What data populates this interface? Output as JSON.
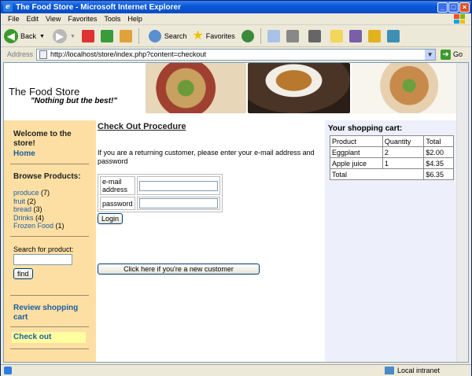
{
  "window": {
    "title": "The Food Store - Microsoft Internet Explorer"
  },
  "menu": [
    "File",
    "Edit",
    "View",
    "Favorites",
    "Tools",
    "Help"
  ],
  "toolbar": {
    "back_label": "Back",
    "search_label": "Search",
    "favorites_label": "Favorites"
  },
  "address": {
    "label": "Address",
    "url": "http://localhost/store/index.php?content=checkout",
    "go_label": "Go"
  },
  "banner": {
    "title": "The Food Store",
    "slogan": "\"Nothing but the best!\""
  },
  "sidebar": {
    "welcome": "Welcome to the store!",
    "home": "Home",
    "browse_heading": "Browse Products:",
    "categories": [
      {
        "name": "produce",
        "count": "(7)"
      },
      {
        "name": "fruit",
        "count": "(2)"
      },
      {
        "name": "bread",
        "count": "(3)"
      },
      {
        "name": "Drinks",
        "count": "(4)"
      },
      {
        "name": "Frozen Food",
        "count": "(1)"
      }
    ],
    "search_label": "Search for product:",
    "search_value": "",
    "find_label": "find",
    "review_cart": "Review shopping cart",
    "checkout": "Check out"
  },
  "main": {
    "heading": "Check Out Procedure",
    "intro": "If you are a returning customer, please enter your e-mail address and password",
    "email_label": "e-mail address",
    "email_value": "",
    "password_label": "password",
    "password_value": "",
    "login_label": "Login",
    "new_customer_label": "Click here if you're a new customer"
  },
  "cart": {
    "heading": "Your shopping cart:",
    "columns": [
      "Product",
      "Quantity",
      "Total"
    ],
    "rows": [
      {
        "product": "Eggplant",
        "quantity": "2",
        "total": "$2.00"
      },
      {
        "product": "Apple juice",
        "quantity": "1",
        "total": "$4.35"
      }
    ],
    "total_label": "Total",
    "total_value": "$6.35"
  },
  "status": {
    "zone": "Local intranet"
  },
  "colors": {
    "sidebar_bg": "#fddfa4",
    "checkout_highlight": "#ffffa0",
    "cart_bg": "#edf0fb",
    "link": "#1b5e9e"
  }
}
